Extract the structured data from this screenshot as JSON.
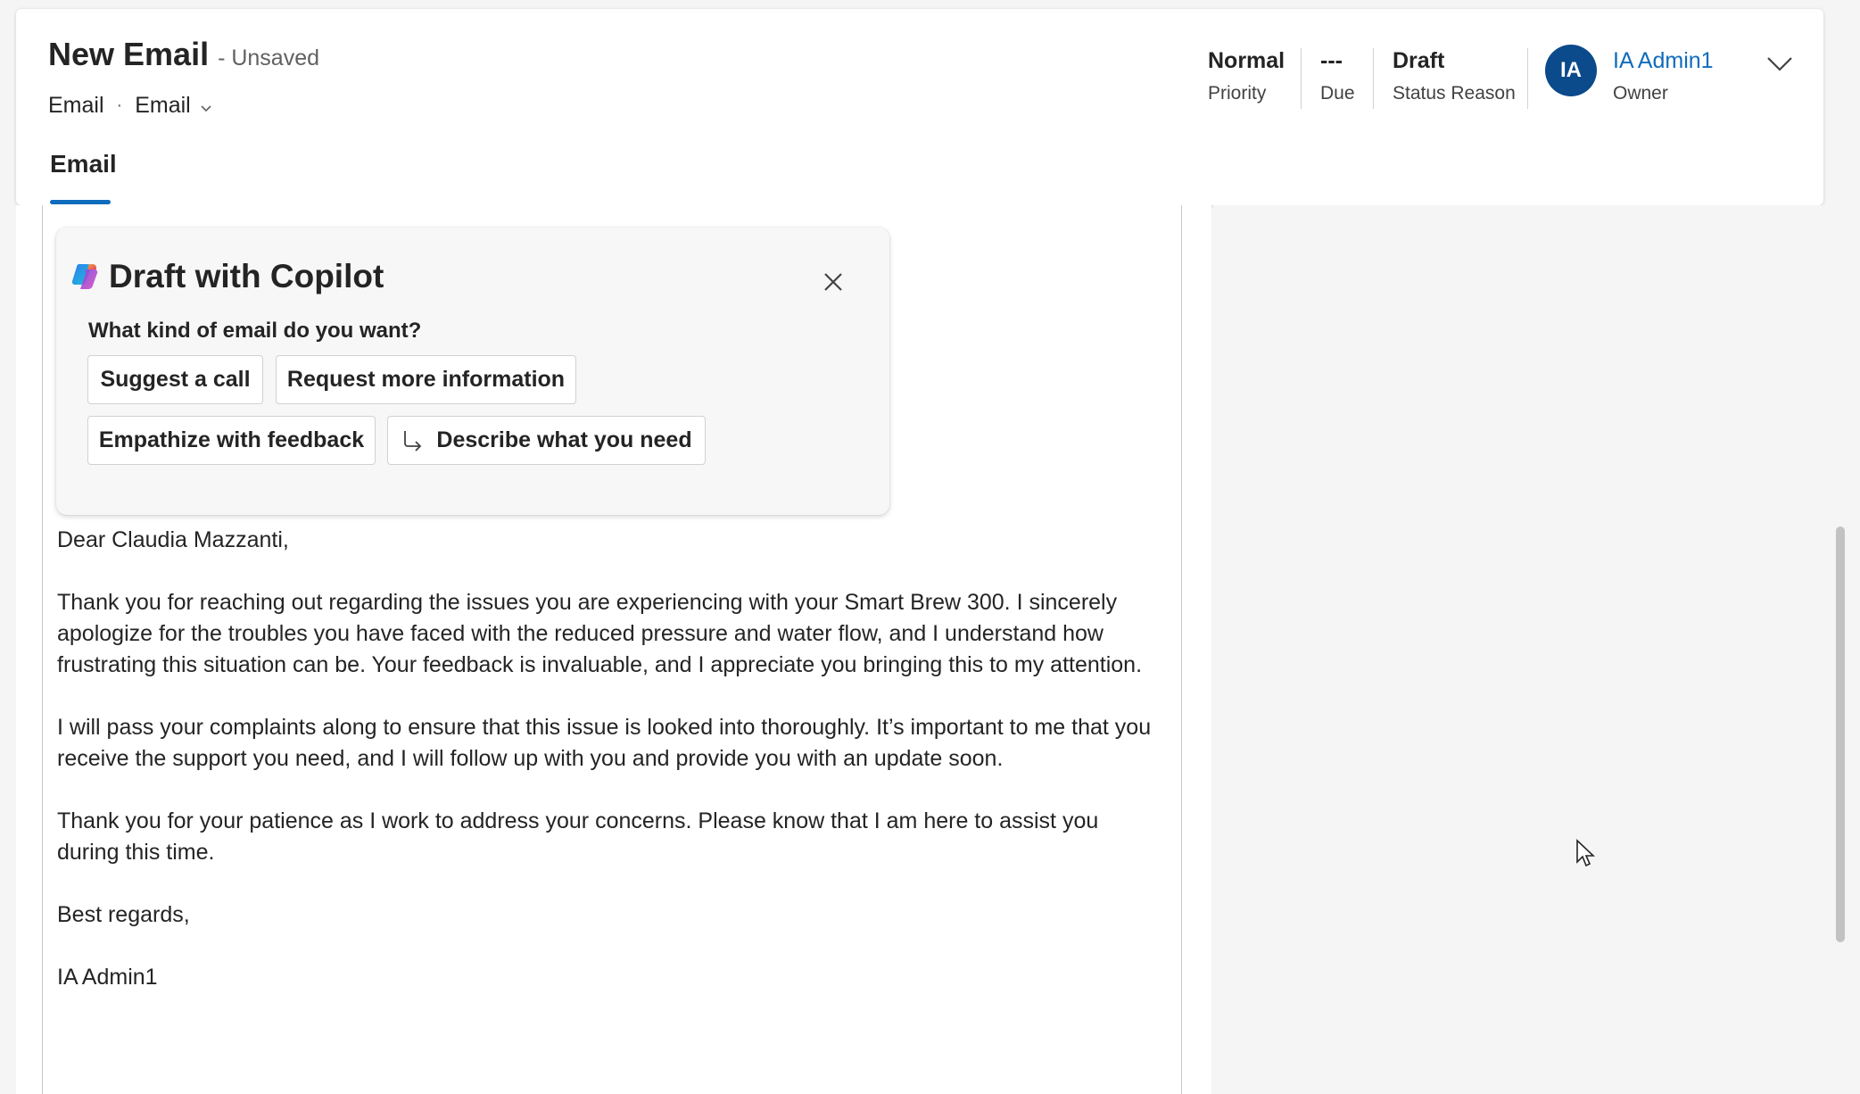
{
  "header": {
    "title": "New Email",
    "save_state": "- Unsaved",
    "entity_type": "Email",
    "separator": "·",
    "form_selector": "Email",
    "tabs": [
      {
        "label": "Email"
      }
    ]
  },
  "header_fields": {
    "priority": {
      "value": "Normal",
      "label": "Priority"
    },
    "due": {
      "value": "---",
      "label": "Due"
    },
    "status_reason": {
      "value": "Draft",
      "label": "Status Reason"
    },
    "owner": {
      "initials": "IA",
      "name": "IA Admin1",
      "label": "Owner",
      "avatar_color": "#0b4a8b"
    }
  },
  "copilot": {
    "title": "Draft with Copilot",
    "question": "What kind of email do you want?",
    "options": [
      {
        "label": "Suggest a call"
      },
      {
        "label": "Request more information"
      },
      {
        "label": "Empathize with feedback"
      },
      {
        "label": "Describe what you need",
        "icon": "arrow-return-icon"
      }
    ]
  },
  "email_body": {
    "greeting": "Dear Claudia Mazzanti,",
    "paragraphs": [
      "Thank you for reaching out regarding the issues you are experiencing with your Smart Brew 300. I sincerely apologize for the troubles you have faced with the reduced pressure and water flow, and I understand how frustrating this situation can be. Your feedback is invaluable, and I appreciate you bringing this to my attention.",
      "I will pass your complaints along to ensure that this issue is looked into thoroughly. It’s important to me that you receive the support you need, and I will follow up with you and provide you with an update soon.",
      "Thank you for your patience as I work to address your concerns. Please know that I am here to assist you during this time."
    ],
    "closing": "Best regards,",
    "signature": "IA Admin1"
  },
  "colors": {
    "accent": "#0f6cbd",
    "avatar": "#0b4a8b"
  }
}
